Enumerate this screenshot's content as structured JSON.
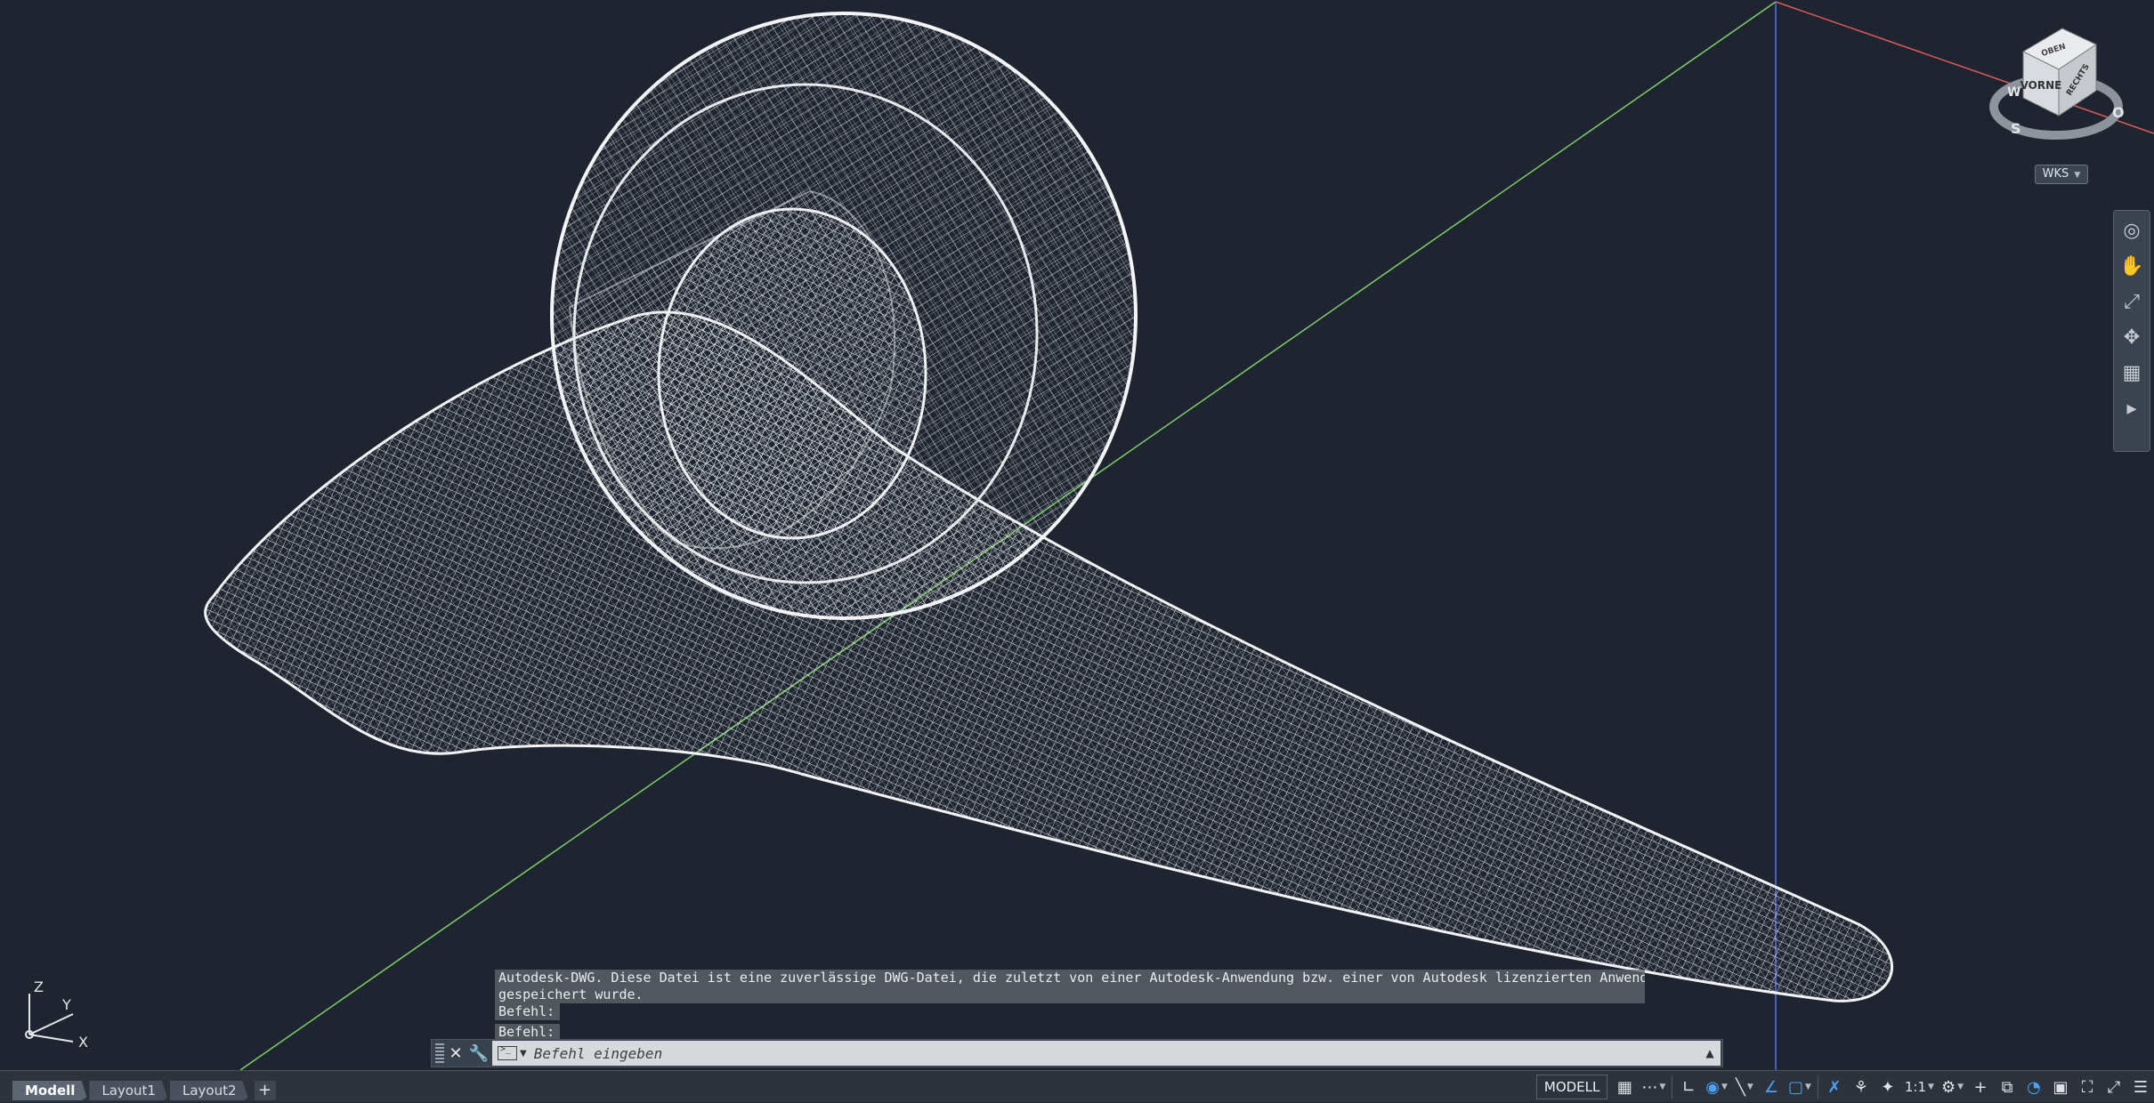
{
  "viewcube": {
    "faces": {
      "top": "OBEN",
      "front": "VORNE",
      "right": "RECHTS"
    },
    "compass": {
      "west": "W",
      "south": "S",
      "east": "O"
    },
    "wcs_label": "WKS"
  },
  "ucs": {
    "z": "Z",
    "y": "Y",
    "x": "X"
  },
  "command": {
    "history": [
      "Autodesk-DWG. Diese Datei ist eine zuverlässige DWG-Datei, die zuletzt von einer Autodesk-Anwendung bzw. einer von Autodesk lizenzierten Anwendung",
      "gespeichert wurde.",
      "Befehl:",
      "Befehl:"
    ],
    "placeholder": "Befehl eingeben",
    "value": ""
  },
  "layout_tabs": [
    {
      "label": "Modell",
      "active": true
    },
    {
      "label": "Layout1",
      "active": false
    },
    {
      "label": "Layout2",
      "active": false
    }
  ],
  "status": {
    "space_label": "MODELL",
    "annotation_scale": "1:1"
  },
  "icons": {
    "close": "close-icon",
    "customize": "wrench-icon",
    "add_layout": "plus-icon",
    "grid": "grid-icon",
    "snap": "snap-icon",
    "ortho": "ortho-icon",
    "polar": "polar-icon",
    "osnap": "object-snap-icon",
    "workspace": "gear-icon",
    "menu": "hamburger-icon"
  },
  "colors": {
    "viewport_bg": "#1e2530",
    "wireframe": "#e8e8e8",
    "axis_x": "#e05a5a",
    "axis_y": "#7fcf6a",
    "axis_z": "#5a70e8",
    "accent": "#4aa3ff"
  }
}
